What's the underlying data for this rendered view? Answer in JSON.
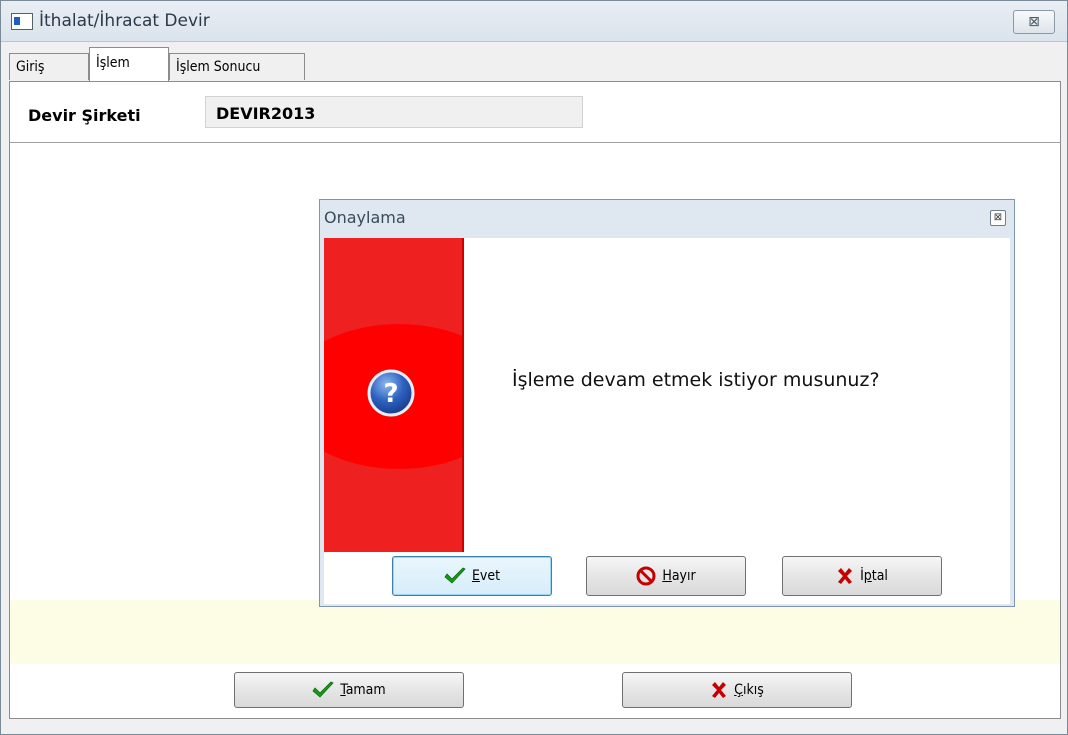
{
  "window": {
    "title": "İthalat/İhracat Devir",
    "close_glyph": "⊠"
  },
  "tabs": [
    {
      "label": "Giriş",
      "active": false
    },
    {
      "label": "İşlem",
      "active": true
    },
    {
      "label": "İşlem Sonucu",
      "active": false
    }
  ],
  "company": {
    "label": "Devir Şirketi",
    "value": "DEVIR2013"
  },
  "footer_buttons": {
    "ok": {
      "mnemonic": "T",
      "rest": "amam",
      "icon": "check-icon"
    },
    "exit": {
      "mnemonic": "Ç",
      "rest": "ıkış",
      "icon": "x-icon"
    }
  },
  "dialog": {
    "title": "Onaylama",
    "close_glyph": "⊠",
    "message": "İşleme devam etmek istiyor musunuz?",
    "icon": "question-icon",
    "buttons": {
      "yes": {
        "mnemonic": "E",
        "rest": "vet",
        "icon": "check-icon"
      },
      "no": {
        "mnemonic": "H",
        "rest": "ayır",
        "icon": "no-entry-icon"
      },
      "cancel": {
        "pre": "İ",
        "mnemonic": "p",
        "rest": "tal",
        "icon": "x-icon"
      }
    }
  },
  "colors": {
    "accent_red": "#ff0000",
    "check_green": "#1a9a1a",
    "x_red": "#c40000",
    "yellow_strip": "#fdfde6"
  }
}
